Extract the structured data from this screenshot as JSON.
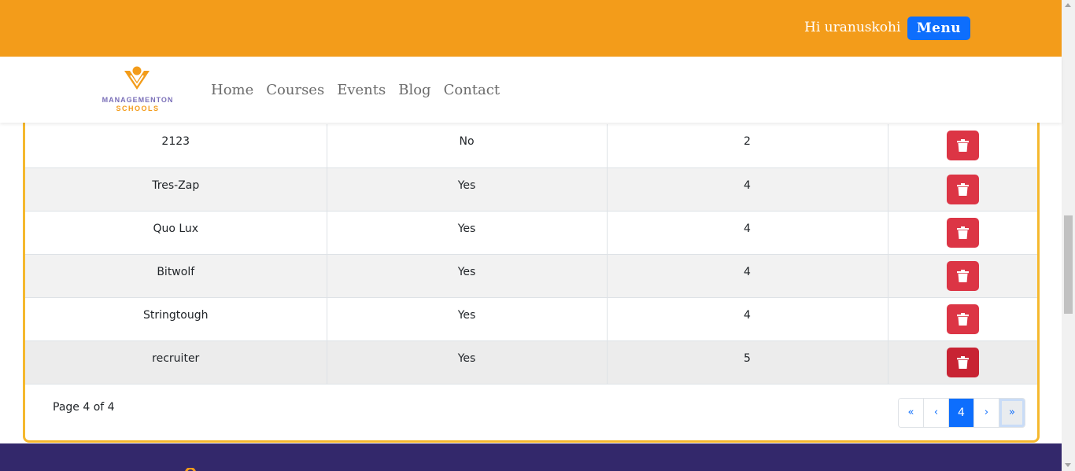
{
  "header": {
    "greeting": "Hi uranuskohi",
    "menu_label": "Menu"
  },
  "logo": {
    "line1": "MANAGEMENTON",
    "line2": "SCHOOLS"
  },
  "nav": {
    "items": [
      {
        "label": "Home"
      },
      {
        "label": "Courses"
      },
      {
        "label": "Events"
      },
      {
        "label": "Blog"
      },
      {
        "label": "Contact"
      }
    ]
  },
  "table": {
    "rows": [
      {
        "name": "2123",
        "flag": "No",
        "count": "2"
      },
      {
        "name": "Tres-Zap",
        "flag": "Yes",
        "count": "4"
      },
      {
        "name": "Quo Lux",
        "flag": "Yes",
        "count": "4"
      },
      {
        "name": "Bitwolf",
        "flag": "Yes",
        "count": "4"
      },
      {
        "name": "Stringtough",
        "flag": "Yes",
        "count": "4"
      },
      {
        "name": "recruiter",
        "flag": "Yes",
        "count": "5"
      }
    ],
    "row_action_icon": "trash-icon"
  },
  "pagination": {
    "info": "Page 4 of 4",
    "first": "«",
    "prev": "‹",
    "current": "4",
    "next": "›",
    "last": "»"
  },
  "colors": {
    "topbar": "#f39c1a",
    "menu_button": "#0d6efd",
    "card_border": "#f5b82e",
    "delete_button": "#dc3545",
    "footer": "#33286b"
  }
}
